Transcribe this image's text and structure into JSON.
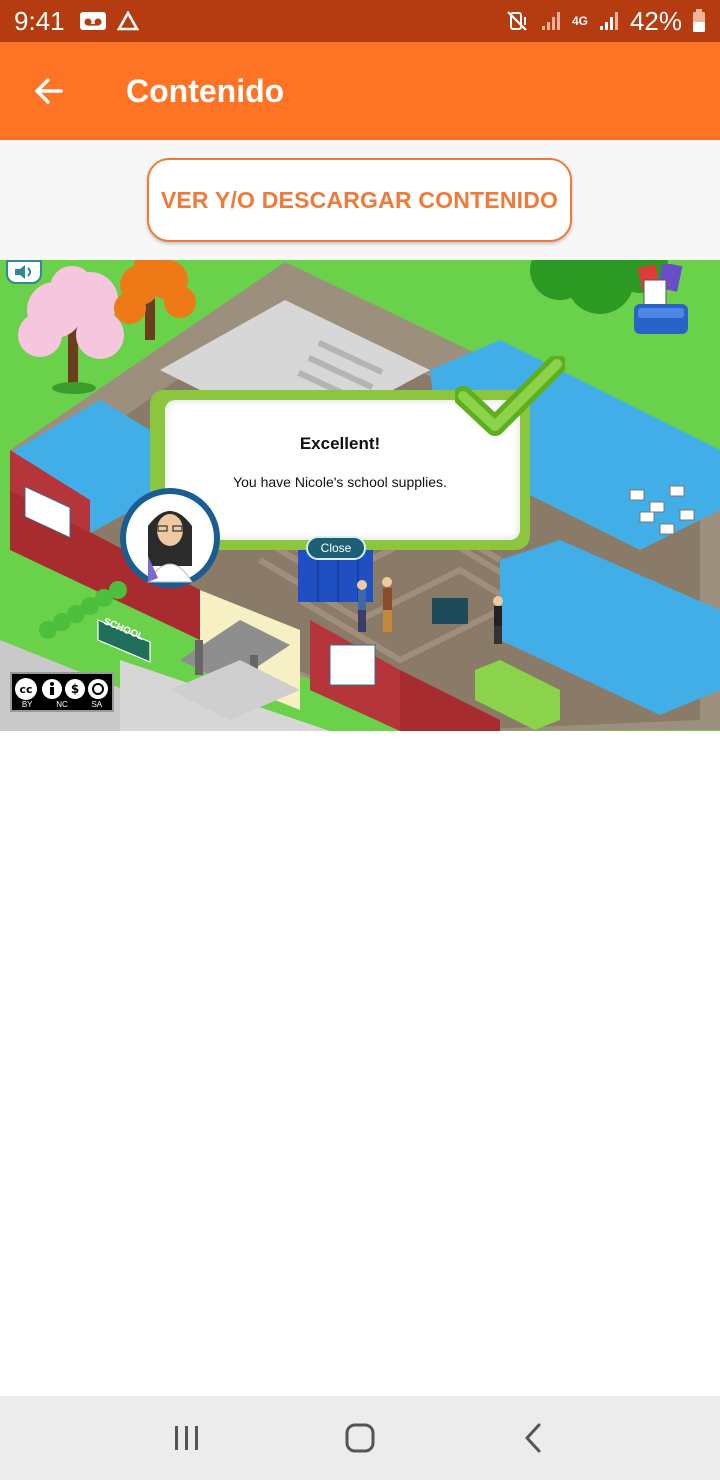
{
  "status_bar": {
    "time": "9:41",
    "battery": "42%",
    "network": "4G",
    "icons": [
      "voicemail-icon",
      "drive-icon",
      "mute-icon",
      "signal-icon",
      "network-4g-icon",
      "signal-icon",
      "battery-icon"
    ]
  },
  "app_bar": {
    "title": "Contenido",
    "back_icon": "arrow-left-icon"
  },
  "download_button": {
    "label": "VER Y/O DESCARGAR CONTENIDO"
  },
  "game": {
    "dialog": {
      "title": "Excellent!",
      "message": "You have Nicole's school supplies.",
      "close_label": "Close"
    },
    "sign_text": "SCHOOL",
    "license": [
      "BY",
      "NC",
      "SA"
    ]
  },
  "colors": {
    "status_bar": "#b53b10",
    "app_bar": "#ff7325",
    "accent": "#f07a3a",
    "grass": "#6ad24a",
    "dialog_border": "#8cc63f"
  },
  "nav_bar": {
    "icons": [
      "recents-icon",
      "home-icon",
      "back-icon"
    ]
  }
}
